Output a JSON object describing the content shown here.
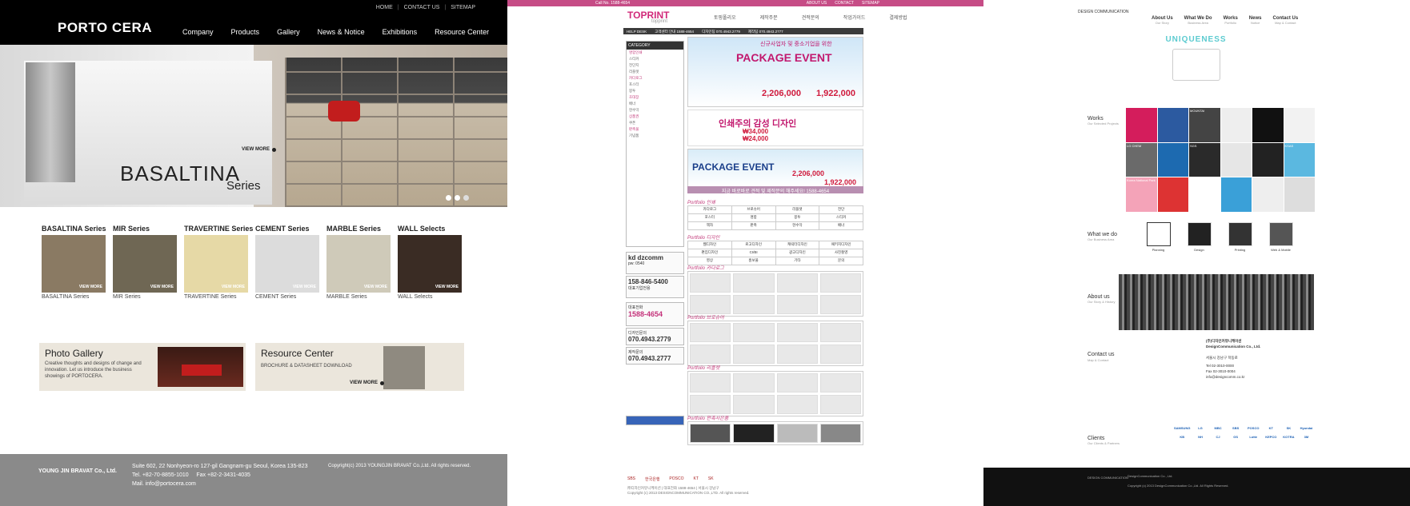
{
  "pane1": {
    "util_links": [
      "HOME",
      "CONTACT US",
      "SITEMAP"
    ],
    "logo": "PORTO CERA",
    "nav": [
      "Company",
      "Products",
      "Gallery",
      "News & Notice",
      "Exhibitions",
      "Resource Center"
    ],
    "hero": {
      "title": "BASALTINA",
      "subtitle": "Series",
      "view_more": "VIEW MORE"
    },
    "series": [
      {
        "name": "BASALTINA Series",
        "caption": "BASALTINA Series",
        "color": "#8a7a63",
        "view_more": "VIEW MORE"
      },
      {
        "name": "MIR Series",
        "caption": "MIR Series",
        "color": "#6f6754",
        "view_more": "VIEW MORE"
      },
      {
        "name": "TRAVERTINE Series",
        "caption": "TRAVERTINE Series",
        "color": "#e6d9a6",
        "view_more": "VIEW MORE"
      },
      {
        "name": "CEMENT Series",
        "caption": "CEMENT Series",
        "color": "#dcdcdc",
        "view_more": "VIEW MORE"
      },
      {
        "name": "MARBLE Series",
        "caption": "MARBLE Series",
        "color": "#cfcab9",
        "view_more": "VIEW MORE"
      },
      {
        "name": "WALL Selects",
        "caption": "WALL Selects",
        "color": "#3a2c24",
        "view_more": "VIEW MORE"
      }
    ],
    "photo_gallery": {
      "title": "Photo Gallery",
      "desc": "Creative thoughts and designs of change and innovation. Let us introduce the business showings of PORTOCERA."
    },
    "resource_center": {
      "title": "Resource Center",
      "desc": "BROCHURE & DATASHEET DOWNLOAD",
      "view_more": "VIEW MORE"
    },
    "footer": {
      "logo": "YOUNG JIN BRAVAT Co., Ltd.",
      "address": "Suite 602, 22 Nonhyeon-ro 127-gil Gangnam-gu Seoul, Korea 135-823",
      "tel": "Tel. +82-70-8855-1010",
      "fax": "Fax +82-2-3431-4035",
      "mail": "Mail. info@portocera.com",
      "copyright": "Copyright(c) 2013 YOUNGJIN BRAVAT Co.,Ltd. All rights reserved."
    }
  },
  "pane2": {
    "topbar_text": "Call No. 1588-4654",
    "topbar_links": [
      "ABOUT US",
      "CONTACT",
      "SITEMAP"
    ],
    "logo": "TOPRINT",
    "logo_sub": "topprint",
    "nav": [
      "토핑폴리오",
      "제작주문",
      "견적문의",
      "작업가이드",
      "결제방법"
    ],
    "helpbar": [
      "HELP DESK",
      "고객센터 안내 1588-4654",
      "디자인팀 070.4943.2779",
      "제작팀 070.4943.2777"
    ],
    "category_title": "CATEGORY",
    "categories": [
      "명함인쇄",
      "스티커",
      "전단지",
      "리플렛",
      "카다로그",
      "포스터",
      "봉투",
      "초대장",
      "배너",
      "현수막",
      "상품권",
      "쿠폰",
      "판촉물",
      "기념품"
    ],
    "side_boxes": [
      {
        "title": "kd dzcomm",
        "sub": "pw: 0540"
      },
      {
        "title": "158-846-5400",
        "sub": "대표기업전용"
      },
      {
        "title": "1588-4654",
        "sub": "대표전화"
      },
      {
        "title": "070.4943.2779",
        "sub": "디자인문의"
      },
      {
        "title": "070.4943.2777",
        "sub": "제작문의"
      }
    ],
    "banner1": {
      "small": "신규사업자 및 중소기업을 위한",
      "title": "PACKAGE EVENT",
      "price1": "2,206,000",
      "price2": "1,922,000"
    },
    "banner2": {
      "title": "인쇄주의 감성 디자인",
      "price1": "₩34,000",
      "price2": "₩24,000"
    },
    "banner3": {
      "title": "PACKAGE EVENT",
      "price1": "2,206,000",
      "price2": "1,922,000"
    },
    "call_bar": "지금 바로바로 견적 및 제작문의 해주세요! 1588-4654",
    "portfolio_sections": [
      "Portfolio 인쇄",
      "Portfolio 디자인",
      "Portfolio 카다로그",
      "Portfolio 브로슈어",
      "Portfolio 리플렛",
      "Portfolio 판촉사은품"
    ],
    "grid1": [
      "카다로그",
      "브로슈어",
      "리플렛",
      "전단",
      "포스터",
      "명함",
      "봉투",
      "스티커",
      "책자",
      "판촉",
      "현수막",
      "배너"
    ],
    "grid2": [
      "웹디자인",
      "로고디자인",
      "캐릭터디자인",
      "패키지디자인",
      "편집디자인",
      "CI/BI",
      "광고디자인",
      "사진촬영",
      "영상",
      "홍보물",
      "기타",
      "문의"
    ],
    "client_logos": [
      "SBS",
      "한국은행",
      "POSCO",
      "KT",
      "SK"
    ],
    "footer_lines": [
      "㈜디자인커뮤니케이션 | 대표전화 1588-4654 | 서울시 강남구",
      "Copyright (c) 2013 DESIGNCOMMUNICATION CO.,LTD. All rights reserved."
    ]
  },
  "pane3": {
    "logo": "DESIGN COMMUNICATION",
    "nav": [
      {
        "label": "About Us",
        "sub": "Our Story"
      },
      {
        "label": "What We Do",
        "sub": "Business Area"
      },
      {
        "label": "Works",
        "sub": "Portfolio"
      },
      {
        "label": "News",
        "sub": "Notice"
      },
      {
        "label": "Contact Us",
        "sub": "Map & Contact"
      }
    ],
    "uniqueness": "UNIQUENESS",
    "works_label": "Works",
    "works_sub": "Our Selected Projects",
    "works_tiles": [
      "",
      "",
      "MOUNTAI",
      "",
      "",
      "",
      "LG CHEM",
      "",
      "SGS",
      "",
      "",
      "KSAS",
      "Korea National Park",
      "",
      "",
      "",
      "",
      ""
    ],
    "what_label": "What we do",
    "what_sub": "Our Business Area",
    "what_items": [
      "Planning",
      "Design",
      "Printing",
      "Web & Mobile"
    ],
    "about_label": "About us",
    "about_sub": "Our Story & History",
    "contact_label": "Contact us",
    "contact_sub": "Map & Contact",
    "company_name": "(주)디자인커뮤니케이션",
    "company_name_en": "DesignCommunication Co., Ltd.",
    "contact_lines": [
      "서울시 강남구 학동로",
      "Tel 02-3010-0000",
      "Fax 02-3010-0004",
      "info@designcomm.co.kr"
    ],
    "clients_label": "Clients",
    "clients_sub": "Our Clients & Partners",
    "clients": [
      "SAMSUNG",
      "LG",
      "MBC",
      "SBS",
      "POSCO",
      "KT",
      "SK",
      "Hyundai",
      "KB",
      "NH",
      "CJ",
      "GS",
      "Lotte",
      "KEPCO",
      "KOTRA",
      "3M"
    ],
    "footer_lines": [
      "DesignCommunication Co., Ltd.",
      "Copyright (c) 2013 DesignCommunication Co.,Ltd. All Rights Reserved."
    ]
  }
}
